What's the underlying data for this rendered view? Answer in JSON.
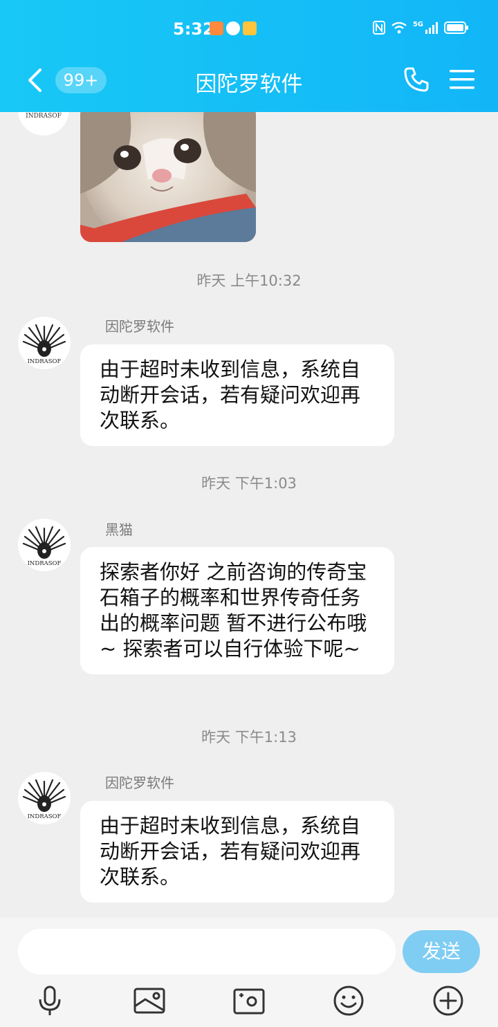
{
  "status_bar": {
    "time": "5:32",
    "network": "5G"
  },
  "header": {
    "unread_badge": "99+",
    "title": "因陀罗软件"
  },
  "avatar_text": "INDRASOF",
  "messages": [
    {
      "timestamp": "昨天 上午10:32",
      "sender": "因陀罗软件",
      "text": "由于超时未收到信息，系统自动断开会话，若有疑问欢迎再次联系。"
    },
    {
      "timestamp": "昨天 下午1:03",
      "sender": "黑猫",
      "text": "探索者你好  之前咨询的传奇宝石箱子的概率和世界传奇任务出的概率问题  暂不进行公布哦~  探索者可以自行体验下呢~"
    },
    {
      "timestamp": "昨天 下午1:13",
      "sender": "因陀罗软件",
      "text": "由于超时未收到信息，系统自动断开会话，若有疑问欢迎再次联系。"
    }
  ],
  "composer": {
    "placeholder": "",
    "send_label": "发送"
  },
  "toolbar_icons": [
    "microphone-icon",
    "image-icon",
    "camera-icon",
    "emoji-icon",
    "plus-icon"
  ],
  "colors": {
    "header_bg": "#12b6f7",
    "send_button": "#7fcdf3",
    "chat_bg": "#efefef"
  }
}
